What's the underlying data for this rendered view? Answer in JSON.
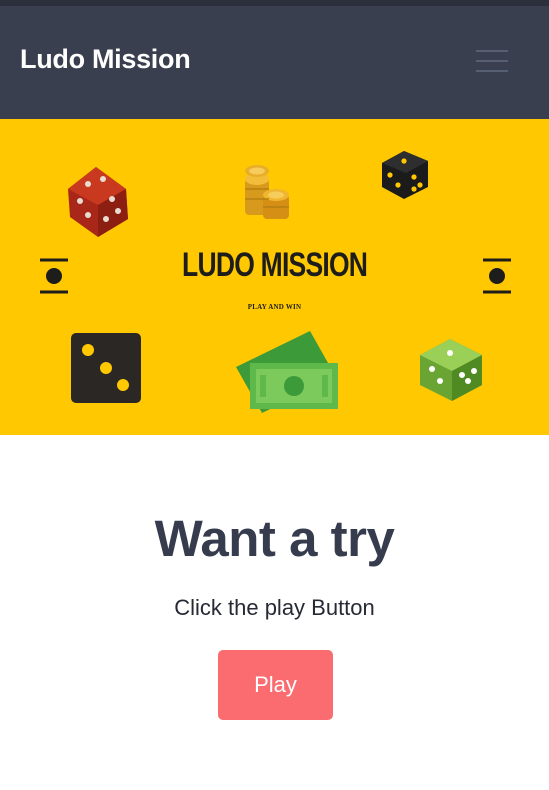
{
  "header": {
    "title": "Ludo Mission",
    "menu_icon": "hamburger-menu-icon"
  },
  "banner": {
    "title": "LUDO MISSION",
    "subtitle": "PLAY AND WIN",
    "background_color": "#ffc800",
    "icons": [
      "red-dice-icon",
      "gold-coins-icon",
      "black-dice-icon",
      "cash-bills-icon",
      "green-dice-icon",
      "token-icon"
    ]
  },
  "main": {
    "headline": "Want a try",
    "instruction": "Click the play Button",
    "play_label": "Play"
  },
  "colors": {
    "header_bg": "#3a3f50",
    "banner_bg": "#ffc800",
    "play_button": "#fa6c70",
    "headline_text": "#363c4e"
  }
}
